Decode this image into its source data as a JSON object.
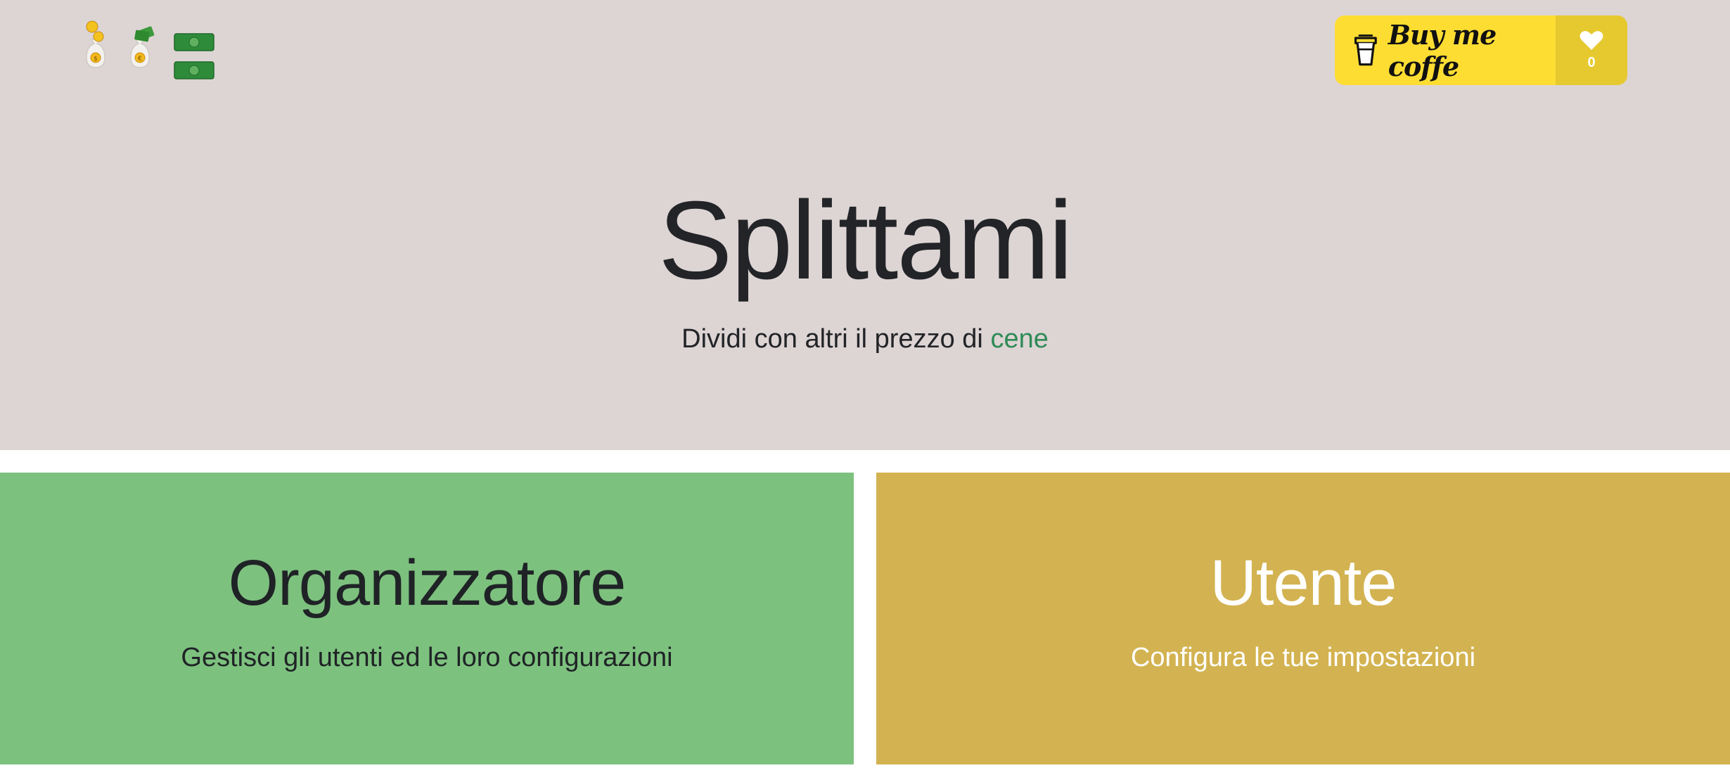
{
  "header": {
    "logo_icon": "money-bags-and-banknotes-icon",
    "support_button": {
      "label": "Buy me coffe",
      "cup_icon": "coffee-cup-icon",
      "heart_icon": "heart-icon",
      "count": "0",
      "color": "#fedd33"
    }
  },
  "hero": {
    "title": "Splittami",
    "subtitle_prefix": "Dividi con altri il prezzo di",
    "subtitle_highlight": "cene",
    "background": "#ddd4d4",
    "accent": "#2e8b57"
  },
  "cards": [
    {
      "title": "Organizzatore",
      "subtitle": "Gestisci gli utenti ed le loro configurazioni",
      "color": "#7dc17e"
    },
    {
      "title": "Utente",
      "subtitle": "Configura le tue impostazioni",
      "color": "#d3b351"
    }
  ]
}
